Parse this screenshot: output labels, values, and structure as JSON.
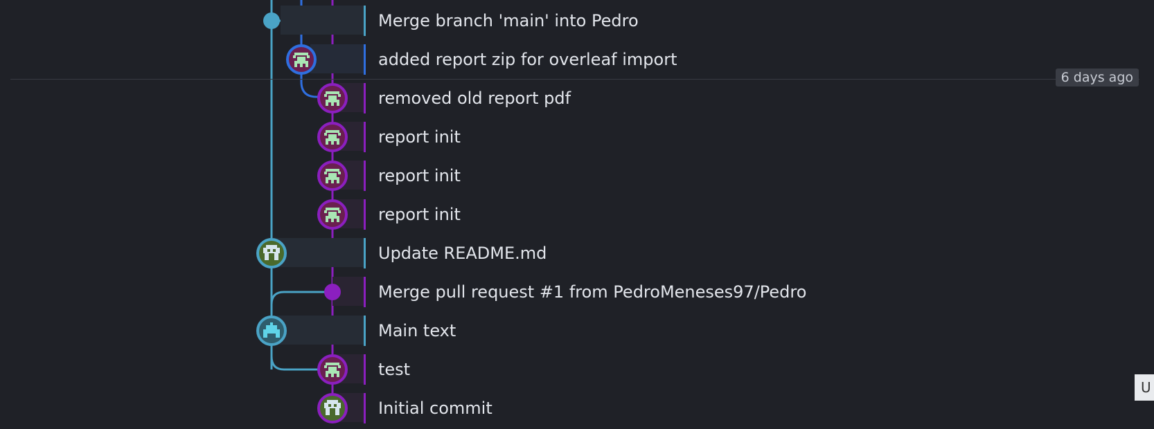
{
  "colors": {
    "background": "#1f2127",
    "lane_main": "#4aa3c6",
    "lane_blue": "#2f6fe0",
    "lane_purple": "#8b1fbf"
  },
  "timeline": {
    "date_label": "6 days ago"
  },
  "side_tab": {
    "label": "U"
  },
  "commits": [
    {
      "message": "Merge branch 'main' into Pedro",
      "lane": "main",
      "avatar": "merge-dot-icon"
    },
    {
      "message": "added report zip for overleaf import",
      "lane": "blue",
      "avatar": "pixel-avatar-icon"
    },
    {
      "message": "removed old report pdf",
      "lane": "purple",
      "avatar": "pixel-avatar-icon"
    },
    {
      "message": "report init",
      "lane": "purple",
      "avatar": "pixel-avatar-icon"
    },
    {
      "message": "report init",
      "lane": "purple",
      "avatar": "pixel-avatar-icon"
    },
    {
      "message": "report init",
      "lane": "purple",
      "avatar": "pixel-avatar-icon"
    },
    {
      "message": "Update README.md",
      "lane": "main",
      "avatar": "pixel-avatar-icon"
    },
    {
      "message": "Merge pull request #1 from PedroMeneses97/Pedro",
      "lane": "purple",
      "avatar": "merge-dot-icon"
    },
    {
      "message": "Main text",
      "lane": "main",
      "avatar": "pixel-avatar-icon"
    },
    {
      "message": "test",
      "lane": "purple",
      "avatar": "pixel-avatar-icon"
    },
    {
      "message": "Initial commit",
      "lane": "purple",
      "avatar": "pixel-avatar-icon"
    }
  ]
}
